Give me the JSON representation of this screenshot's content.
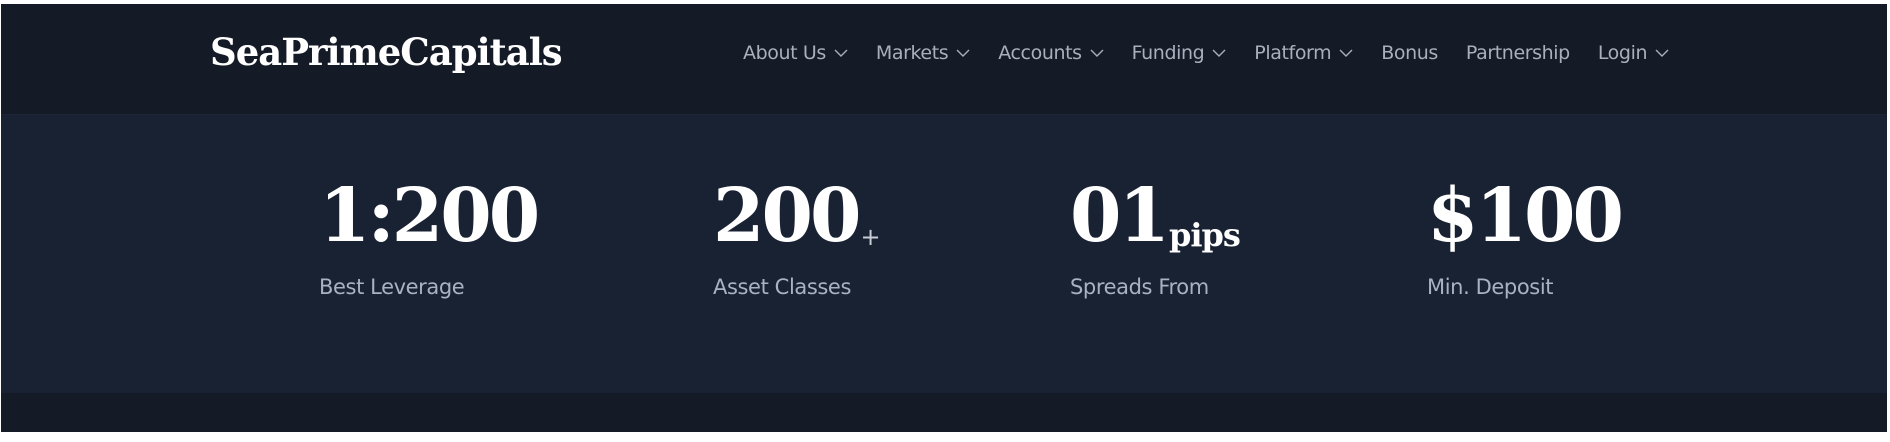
{
  "brand": {
    "logo_text": "SeaPrimeCapitals"
  },
  "nav": {
    "items": [
      {
        "label": "About Us",
        "has_dropdown": true,
        "icon": "chevron-down-icon"
      },
      {
        "label": "Markets",
        "has_dropdown": true,
        "icon": "chevron-down-icon"
      },
      {
        "label": "Accounts",
        "has_dropdown": true,
        "icon": "chevron-down-icon"
      },
      {
        "label": "Funding",
        "has_dropdown": true,
        "icon": "chevron-down-icon"
      },
      {
        "label": "Platform",
        "has_dropdown": true,
        "icon": "chevron-down-icon"
      },
      {
        "label": "Bonus",
        "has_dropdown": false
      },
      {
        "label": "Partnership",
        "has_dropdown": false
      },
      {
        "label": "Login",
        "has_dropdown": true,
        "icon": "chevron-down-icon"
      }
    ]
  },
  "stats": [
    {
      "value": "1:200",
      "suffix": "",
      "label": "Best Leverage"
    },
    {
      "value": "200",
      "suffix": "+",
      "label": "Asset Classes"
    },
    {
      "value": "01",
      "suffix": "pips",
      "label": "Spreads From"
    },
    {
      "value": "$100",
      "suffix": "",
      "label": "Min. Deposit"
    }
  ],
  "colors": {
    "header_bg": "#141a26",
    "stats_bg": "#182233",
    "nav_text": "#a9b0bc",
    "stat_value": "#ffffff",
    "stat_label": "#a7b2c3"
  }
}
